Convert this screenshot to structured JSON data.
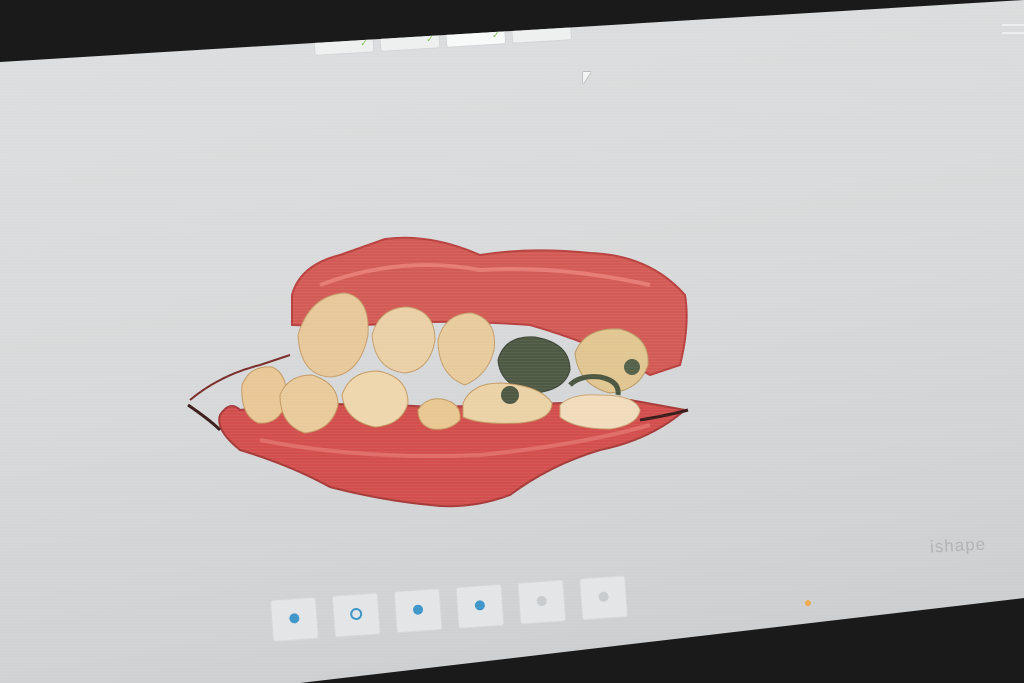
{
  "workflow": {
    "steps": [
      {
        "label": "",
        "icon": "scan-upper-icon",
        "done": true
      },
      {
        "label": "",
        "icon": "scan-lower-icon",
        "done": true
      },
      {
        "label": "",
        "icon": "bite-scan-icon",
        "done": true,
        "active": true
      },
      {
        "label": "",
        "icon": "send-case-icon",
        "done": false
      }
    ],
    "check_mark": "✓"
  },
  "viewport": {
    "model": "intraoral-3d-scan"
  },
  "bottom_tools": [
    {
      "label": "",
      "icon": "tool-home-icon"
    },
    {
      "label": "",
      "icon": "tool-view-icon"
    },
    {
      "label": "",
      "icon": "tool-shade-icon"
    },
    {
      "label": "",
      "icon": "tool-camera-icon"
    },
    {
      "label": "",
      "icon": "tool-faint-icon"
    },
    {
      "label": "",
      "icon": "tool-edit-icon"
    }
  ],
  "brand": "ishape",
  "status_text": "",
  "colors": {
    "accent": "#3d95c9",
    "check": "#7bbf45",
    "gum": "#d6504f",
    "tooth": "#e6c999",
    "background": "#d7d9da"
  }
}
